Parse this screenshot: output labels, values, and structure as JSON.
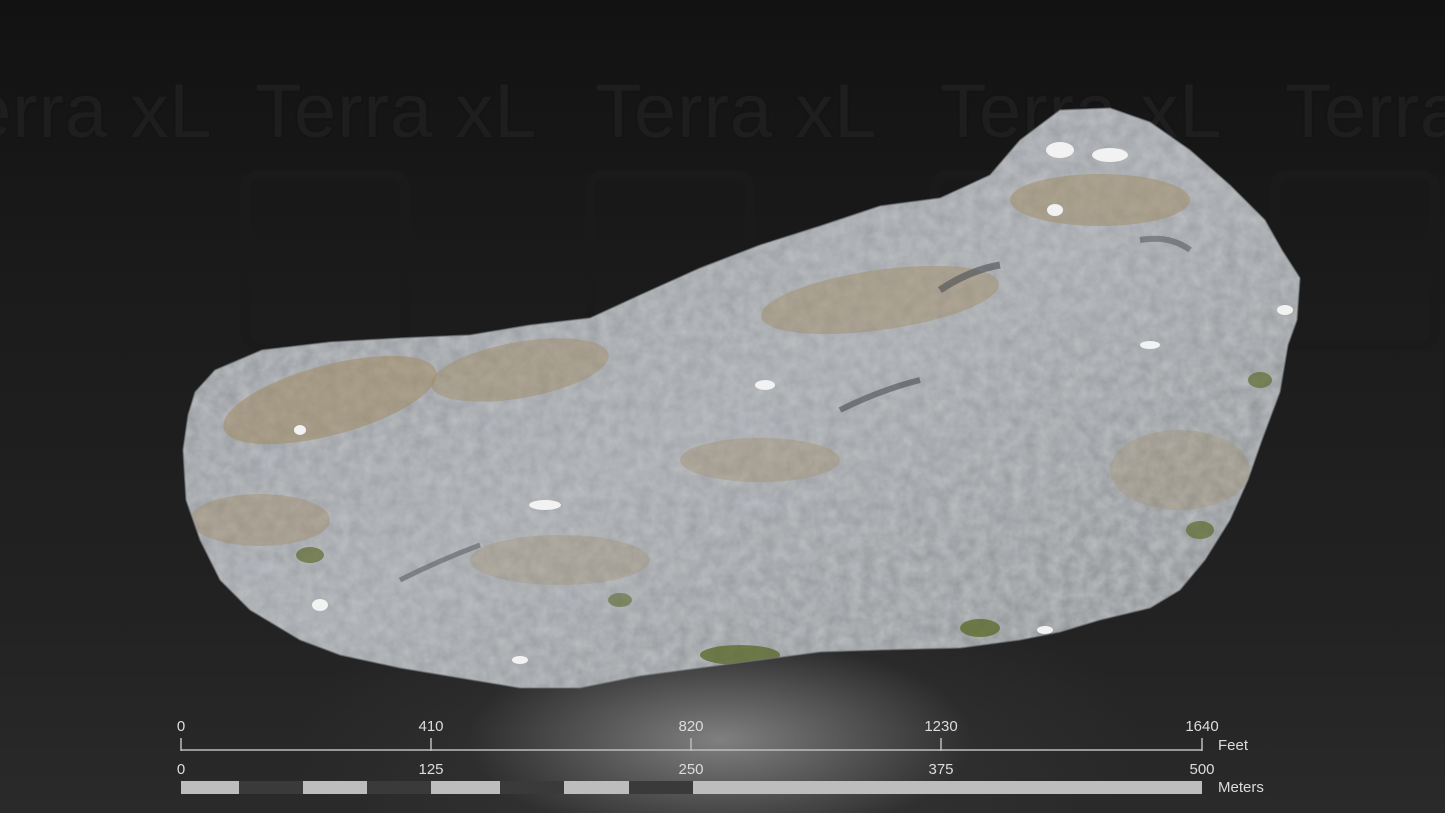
{
  "watermark": {
    "text": "Terra xL",
    "instances": [
      "Terra xL",
      "Terra xL",
      "Terra xL",
      "Terra xL",
      "Terra xL"
    ]
  },
  "model": {
    "icon": "rock-outcrop-3d-model",
    "colors": {
      "rock": "#9a9ea3",
      "grass": "#a08a62",
      "moss": "#5e6a2e",
      "snow": "#f2f2f2"
    }
  },
  "scale_bar": {
    "feet": {
      "ticks": [
        "0",
        "410",
        "820",
        "1230",
        "1640"
      ],
      "unit": "Feet"
    },
    "meters": {
      "ticks": [
        "0",
        "125",
        "250",
        "375",
        "500"
      ],
      "unit": "Meters"
    },
    "colors": {
      "light": "#bdbdbd",
      "dark": "#3a3a3a",
      "line": "#bdbdbd"
    }
  }
}
